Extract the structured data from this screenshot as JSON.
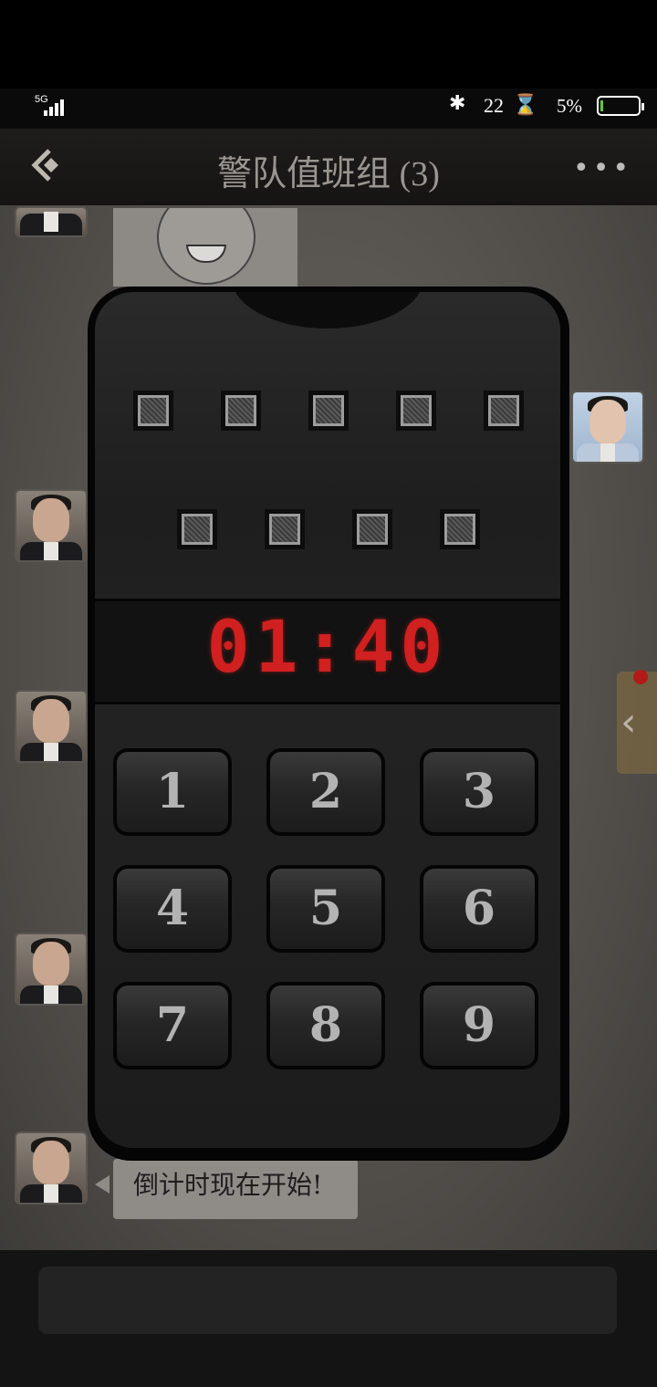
{
  "status_bar": {
    "network": "5G",
    "time": "22",
    "battery_percent": "5%"
  },
  "header": {
    "title": "警队值班组 (3)"
  },
  "chat": {
    "last_message": "倒计时现在开始!"
  },
  "keypad": {
    "timer": "01:40",
    "code_slots_row1": 5,
    "code_slots_row2": 4,
    "keys": [
      "1",
      "2",
      "3",
      "4",
      "5",
      "6",
      "7",
      "8",
      "9"
    ]
  },
  "colors": {
    "timer": "#d0201f",
    "notification_dot": "#b21a17",
    "battery_fill": "#5fc93a"
  },
  "icons": {
    "back": "back-icon",
    "more": "more-icon",
    "bluetooth": "bluetooth-icon",
    "side_tab": "chevron-left-icon"
  }
}
